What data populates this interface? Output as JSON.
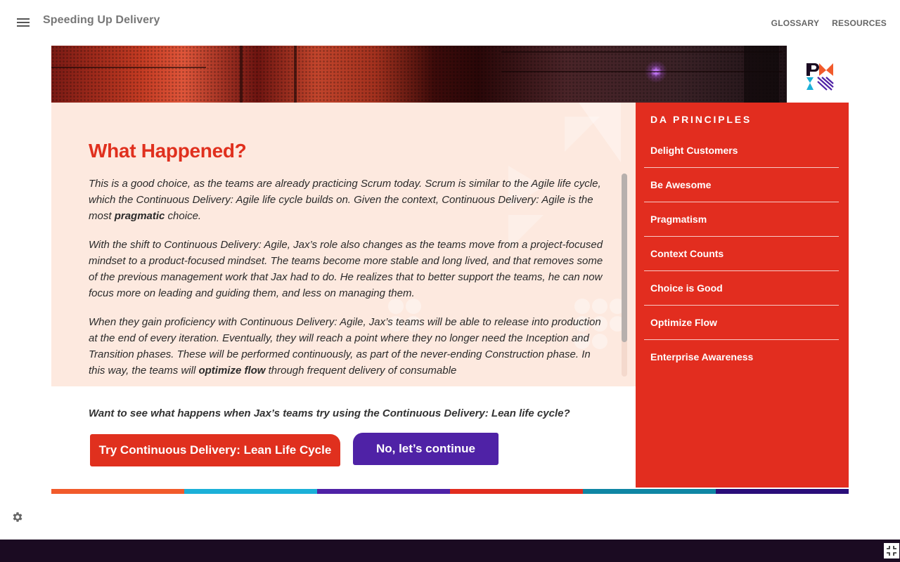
{
  "header": {
    "menu_icon": "hamburger-menu-icon",
    "title": "Speeding Up Delivery",
    "nav": [
      {
        "label": "GLOSSARY"
      },
      {
        "label": "RESOURCES"
      }
    ]
  },
  "logo": {
    "name": "pmi-logo"
  },
  "main": {
    "heading": "What Happened?",
    "paragraphs": [
      {
        "before": "This is a good choice, as the teams are already practicing Scrum today. Scrum is similar to the Agile life cycle, which the Continuous Delivery: Agile life cycle builds on. Given the context, Continuous Delivery: Agile is the most ",
        "bold": "pragmatic",
        "after": " choice."
      },
      {
        "text": "With the shift to Continuous Delivery: Agile, Jax’s role also changes as the teams move from a project-focused mindset to a product-focused mindset. The teams become more stable and long lived, and that removes some of the previous management work that Jax had to do. He realizes that to better support the teams, he can now focus more on leading and guiding them, and less on managing them."
      },
      {
        "before": "When they gain proficiency with Continuous Delivery: Agile, Jax’s teams will be able to release into production at the end of every iteration. Eventually, they will reach a point where they no longer need the Inception and Transition phases. These will be performed continuously, as part of the never-ending Construction phase. In this way, the teams will ",
        "bold": "optimize flow",
        "after": " through frequent delivery of consumable"
      }
    ],
    "question": "Want to see what happens when Jax’s teams try using the Continuous Delivery: Lean life cycle?",
    "buttons": {
      "primary": "Try Continuous Delivery: Lean Life Cycle",
      "secondary": "No, let’s continue"
    }
  },
  "principles": {
    "title": "DA PRINCIPLES",
    "items": [
      {
        "label": "Delight Customers"
      },
      {
        "label": "Be Awesome"
      },
      {
        "label": "Pragmatism"
      },
      {
        "label": "Context Counts"
      },
      {
        "label": "Choice is Good"
      },
      {
        "label": "Optimize Flow"
      },
      {
        "label": "Enterprise Awareness"
      }
    ]
  },
  "colors": {
    "accent_red": "#e0301e",
    "accent_purple": "#4f22a6",
    "content_bg": "#fde9df",
    "footer_bg": "#1b0b22",
    "color_bar": [
      "#f15a2b",
      "#1bb0d8",
      "#4f22a6",
      "#e22d1f",
      "#0f86a4",
      "#2a0e7a"
    ]
  },
  "icons": {
    "settings": "gear-icon",
    "fullscreen": "exit-fullscreen-icon"
  }
}
